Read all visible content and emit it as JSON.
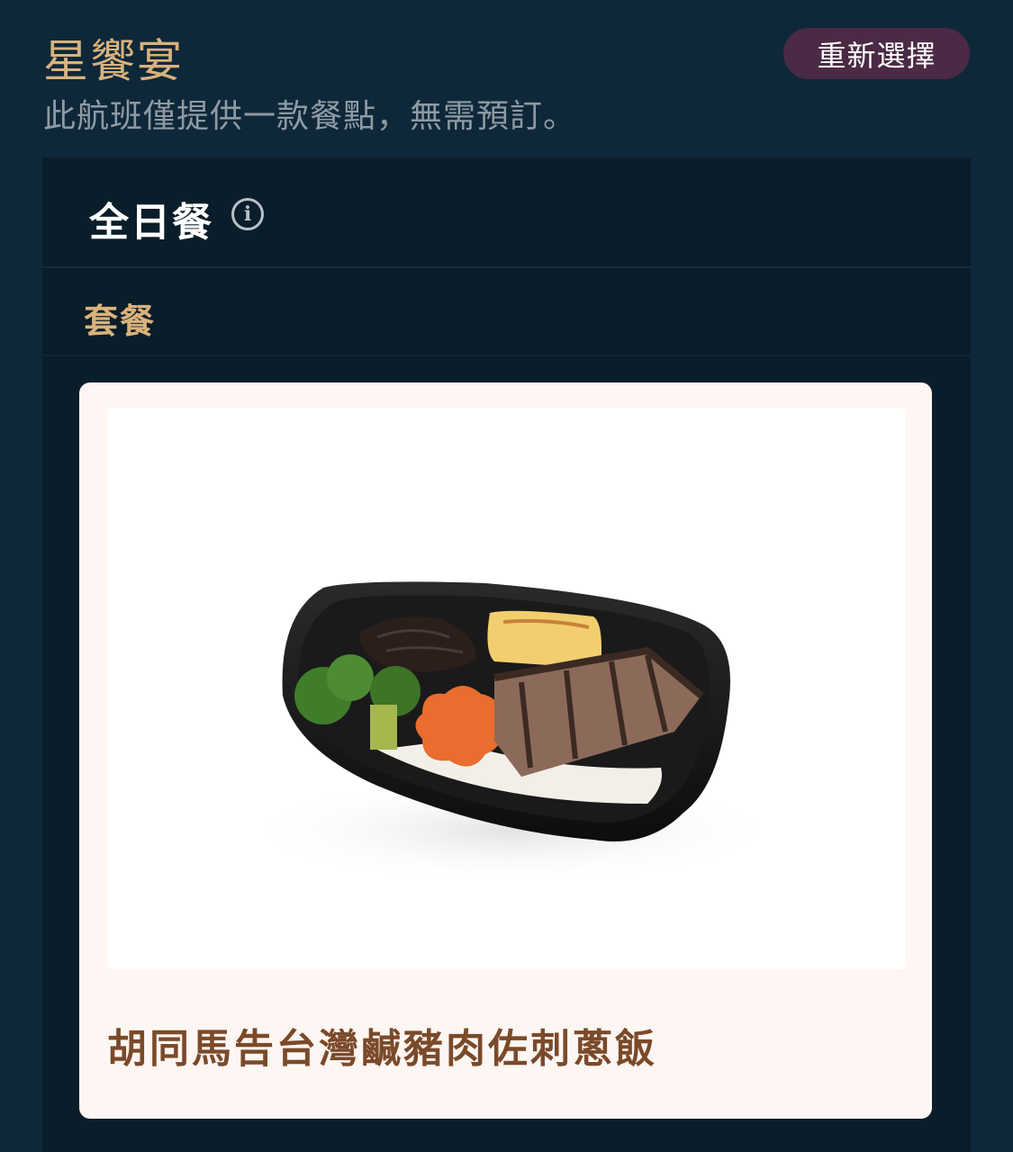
{
  "header": {
    "title": "星饗宴",
    "subtitle": "此航班僅提供一款餐點，無需預訂。",
    "reselect_label": "重新選擇"
  },
  "meal": {
    "title": "全日餐",
    "info_icon": "info-icon",
    "category": "套餐",
    "dish": {
      "name": "胡同馬告台灣鹹豬肉佐刺蔥飯",
      "image": "bento-box-photo"
    }
  },
  "colors": {
    "background": "#0f2839",
    "panel": "#0a1d2a",
    "accent_gold": "#d9b27d",
    "button": "#4a2a45",
    "card": "#fdf6f2",
    "dish_name": "#7a4a2a"
  }
}
